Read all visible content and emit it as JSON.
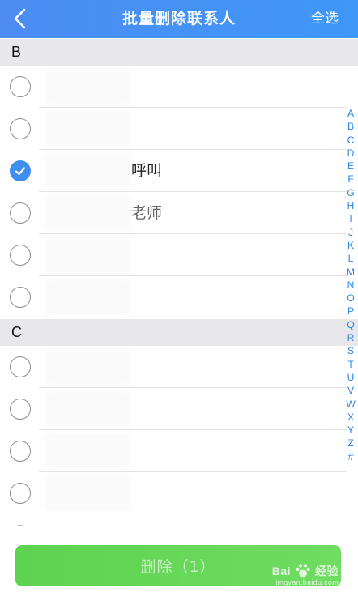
{
  "header": {
    "title": "批量删除联系人",
    "select_all_label": "全选"
  },
  "sections": [
    {
      "letter": "B",
      "contacts": [
        {
          "name": "",
          "checked": false
        },
        {
          "name": "",
          "checked": false
        },
        {
          "name": "呼叫",
          "checked": true
        },
        {
          "name": "老师",
          "checked": false
        },
        {
          "name": "",
          "checked": false
        },
        {
          "name": "",
          "checked": false
        }
      ]
    },
    {
      "letter": "C",
      "contacts": [
        {
          "name": "",
          "checked": false
        },
        {
          "name": "",
          "checked": false
        },
        {
          "name": "",
          "checked": false
        },
        {
          "name": "",
          "checked": false
        }
      ]
    }
  ],
  "alphabet_index": [
    "A",
    "B",
    "C",
    "D",
    "E",
    "F",
    "G",
    "H",
    "I",
    "J",
    "K",
    "L",
    "M",
    "N",
    "O",
    "P",
    "Q",
    "R",
    "S",
    "T",
    "U",
    "V",
    "W",
    "X",
    "Y",
    "Z",
    "#"
  ],
  "delete_button": {
    "label": "删除（1）"
  },
  "watermark": {
    "brand": "Bai",
    "brand_suffix": "经验",
    "url": "jingyan.baidu.com"
  },
  "colors": {
    "header_bg": "#4c8cf3",
    "accent": "#3d8ef0",
    "index_text": "#2a84e8",
    "delete_button_bg": "#5ed34f",
    "section_bg": "#e8e8ea"
  },
  "icons": {
    "back": "chevron-left-icon",
    "check": "checkmark-icon",
    "logo": "paw-icon"
  }
}
